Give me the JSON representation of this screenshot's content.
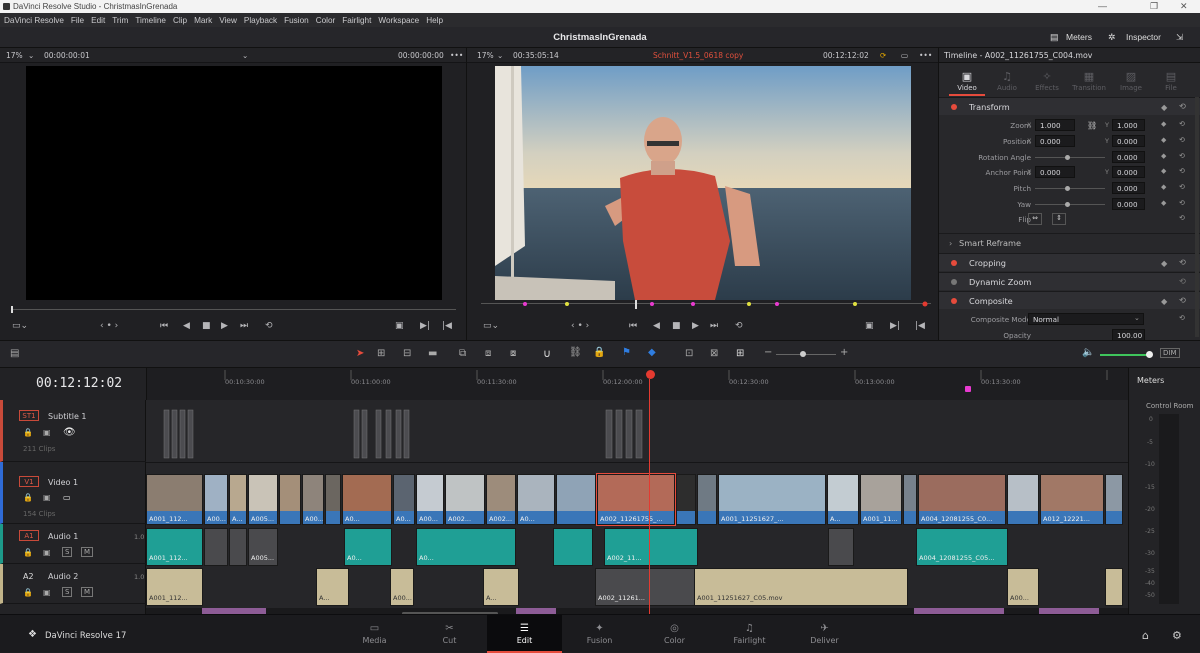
{
  "window": {
    "title": "DaVinci Resolve Studio - ChristmasInGrenada"
  },
  "menu": [
    "DaVinci Resolve",
    "File",
    "Edit",
    "Trim",
    "Timeline",
    "Clip",
    "Mark",
    "View",
    "Playback",
    "Fusion",
    "Color",
    "Fairlight",
    "Workspace",
    "Help"
  ],
  "header": {
    "project": "ChristmasInGrenada",
    "meters_label": "Meters",
    "inspector_label": "Inspector"
  },
  "source_viewer": {
    "zoom": "17%",
    "timecode_left": "00:00:00:01",
    "timecode_right": "00:00:00:00",
    "more": "•••"
  },
  "timeline_viewer": {
    "zoom": "17%",
    "duration": "00:35:05:14",
    "timeline_name": "Schnitt_V1.5_0618 copy",
    "timecode": "00:12:12:02"
  },
  "inspector": {
    "title": "Timeline - A002_11261755_C004.mov",
    "tabs": [
      "Video",
      "Audio",
      "Effects",
      "Transition",
      "Image",
      "File"
    ],
    "transform_label": "Transform",
    "zoom": {
      "label": "Zoom",
      "x": "1.000",
      "y": "1.000"
    },
    "position": {
      "label": "Position",
      "x": "0.000",
      "y": "0.000"
    },
    "rotation": {
      "label": "Rotation Angle",
      "value": "0.000"
    },
    "anchor": {
      "label": "Anchor Point",
      "x": "0.000",
      "y": "0.000"
    },
    "pitch": {
      "label": "Pitch",
      "value": "0.000"
    },
    "yaw": {
      "label": "Yaw",
      "value": "0.000"
    },
    "flip": {
      "label": "Flip"
    },
    "smart_reframe": "Smart Reframe",
    "cropping": "Cropping",
    "dynamic_zoom": "Dynamic Zoom",
    "composite": "Composite",
    "composite_mode": {
      "label": "Composite Mode",
      "value": "Normal"
    },
    "opacity": {
      "label": "Opacity",
      "value": "100.00"
    },
    "accent": "#e64b3c"
  },
  "timeline": {
    "timecode": "00:12:12:02",
    "ticks": [
      "00:10:30:00",
      "00:11:00:00",
      "00:11:30:00",
      "00:12:00:00",
      "00:12:30:00",
      "00:13:00:00",
      "00:13:30:00"
    ],
    "tracks": {
      "st1": {
        "id": "ST1",
        "name": "Subtitle 1",
        "count": "211 Clips"
      },
      "v1": {
        "id": "V1",
        "name": "Video 1",
        "count": "154 Clips"
      },
      "a1": {
        "id": "A1",
        "name": "Audio 1",
        "ch": "1.0"
      },
      "a2": {
        "id": "A2",
        "name": "Audio 2",
        "ch": "1.0"
      }
    },
    "video_clips": [
      "A001_112...",
      "A00...",
      "A...",
      "A005...",
      "A00...",
      "A0...",
      "A0...",
      "A00...",
      "A002...",
      "A002...",
      "A0...",
      "A002_11261755_...",
      "A001_11251627_...",
      "A...",
      "A001_11...",
      "A004_12081255_C0...",
      "A012_12221..."
    ],
    "audio1_clips": [
      "A001_112...",
      "A005...",
      "A0...",
      "A0...",
      "A002_11...",
      "A004_12081255_C05..."
    ],
    "audio2_clips": [
      "A001_112...",
      "A...",
      "A00...",
      "A...",
      "A002_11261...",
      "A001_11251627_C05.mov",
      "A00..."
    ]
  },
  "meters": {
    "title": "Meters",
    "bus": "Control Room",
    "scale": [
      "0",
      "-5",
      "-10",
      "-15",
      "-20",
      "-25",
      "-30",
      "-35",
      "-40",
      "-50"
    ]
  },
  "pages": [
    "Media",
    "Cut",
    "Edit",
    "Fusion",
    "Color",
    "Fairlight",
    "Deliver"
  ],
  "app_name": "DaVinci Resolve 17"
}
